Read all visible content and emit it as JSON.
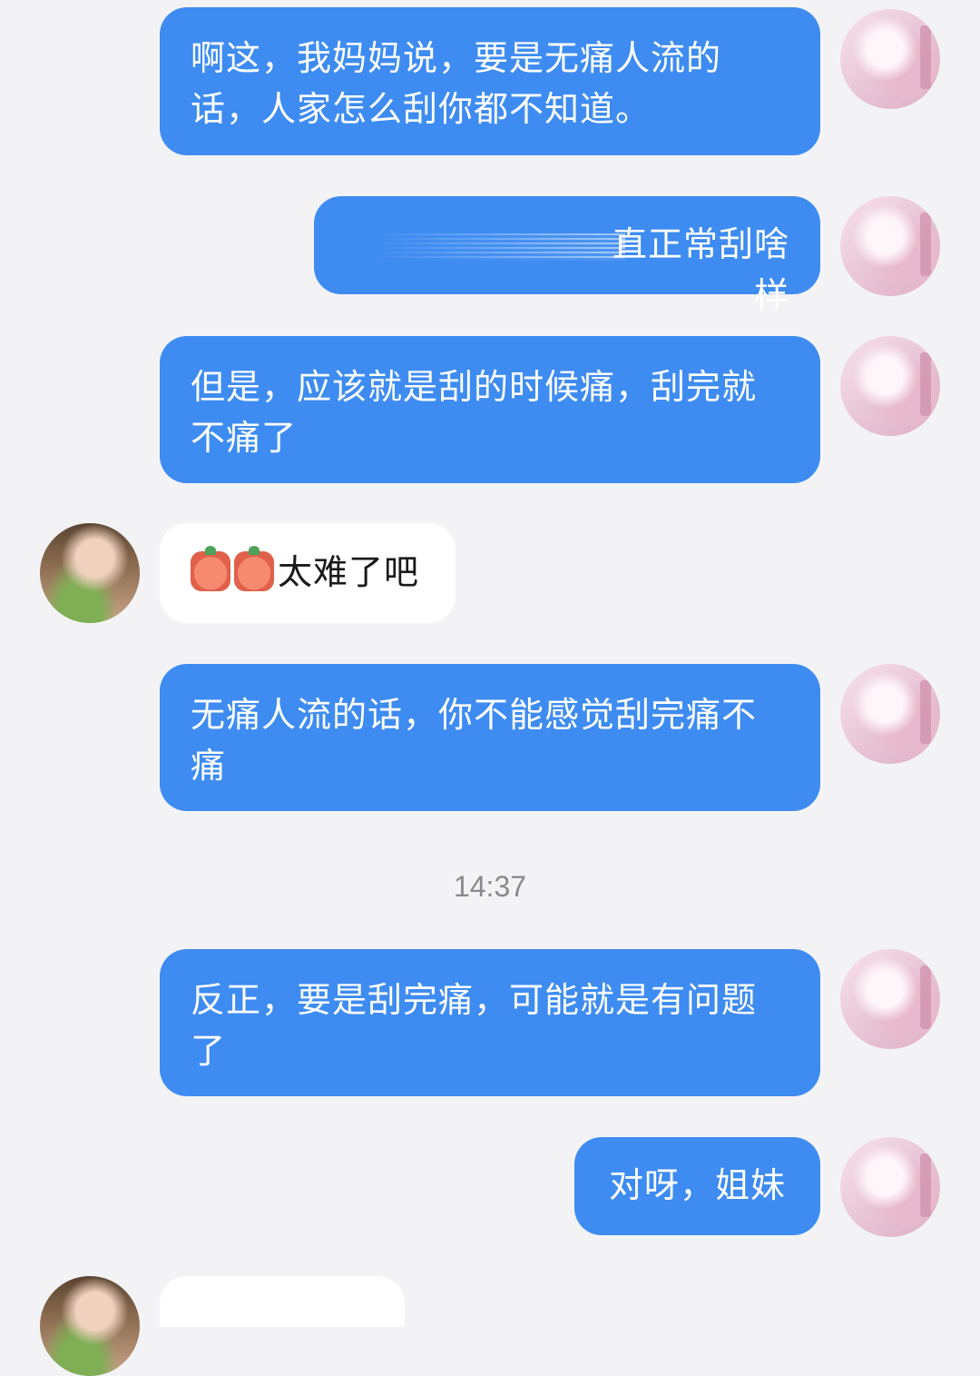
{
  "messages": [
    {
      "sender": "me",
      "text": "啊这，我妈妈说，要是无痛人流的话，人家怎么刮你都不知道。"
    },
    {
      "sender": "me",
      "text": "直正常刮啥样",
      "redacted_prefix": true
    },
    {
      "sender": "me",
      "text": "但是，应该就是刮的时候痛，刮完就不痛了"
    },
    {
      "sender": "them",
      "text": "太难了吧",
      "emoji": [
        "crying-emoji",
        "crying-emoji"
      ]
    },
    {
      "sender": "me",
      "text": "无痛人流的话，你不能感觉刮完痛不痛"
    },
    {
      "sender": "me",
      "text": "反正，要是刮完痛，可能就是有问题了"
    },
    {
      "sender": "me",
      "text": "对呀，姐妹"
    },
    {
      "sender": "them",
      "text": ""
    }
  ],
  "timestamp": "14:37",
  "colors": {
    "background": "#f3f3f5",
    "my_bubble": "#3e8cf1",
    "their_bubble": "#ffffff",
    "timestamp_text": "#8a8a8a"
  }
}
